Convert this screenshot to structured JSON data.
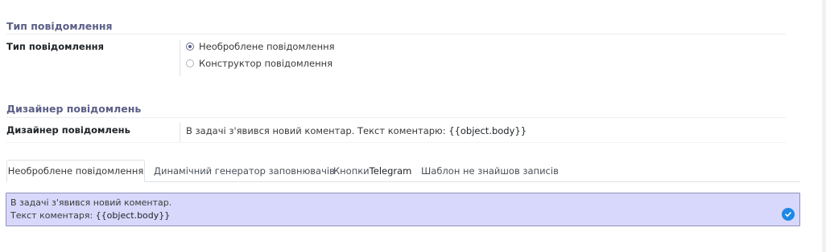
{
  "message_type_section": {
    "title": "Тип повідомлення",
    "field_label": "Тип повідомлення",
    "options": [
      {
        "label": "Необроблене повідомлення",
        "selected": true
      },
      {
        "label": "Конструктор повідомлення",
        "selected": false
      }
    ]
  },
  "designer_section": {
    "title": "Дизайнер повідомлень",
    "field_label": "Дизайнер повідомлень",
    "value_text": "В задачі з'явився новий коментар. Текст коментарю: ",
    "value_placeholder": "{{object.body}}"
  },
  "tabs": [
    {
      "label": "Необроблене повідомлення",
      "active": true
    },
    {
      "label": "Динамічний генератор заповнювачів",
      "active": false
    },
    {
      "label_prefix": "Кнопки ",
      "label_suffix": "Telegram",
      "active": false
    },
    {
      "label": "Шаблон не знайшов записів",
      "active": false
    }
  ],
  "editor": {
    "line1": "В задачі з'явився новий коментар.",
    "line2_text": "Текст коментаря: ",
    "line2_placeholder": "{{object.body}}",
    "badge_icon": "check-icon",
    "badge_color": "#1e88e5"
  },
  "colors": {
    "section_title": "#5b5f86",
    "editor_bg": "#d8d8fc",
    "editor_border": "#8f8fbb"
  }
}
